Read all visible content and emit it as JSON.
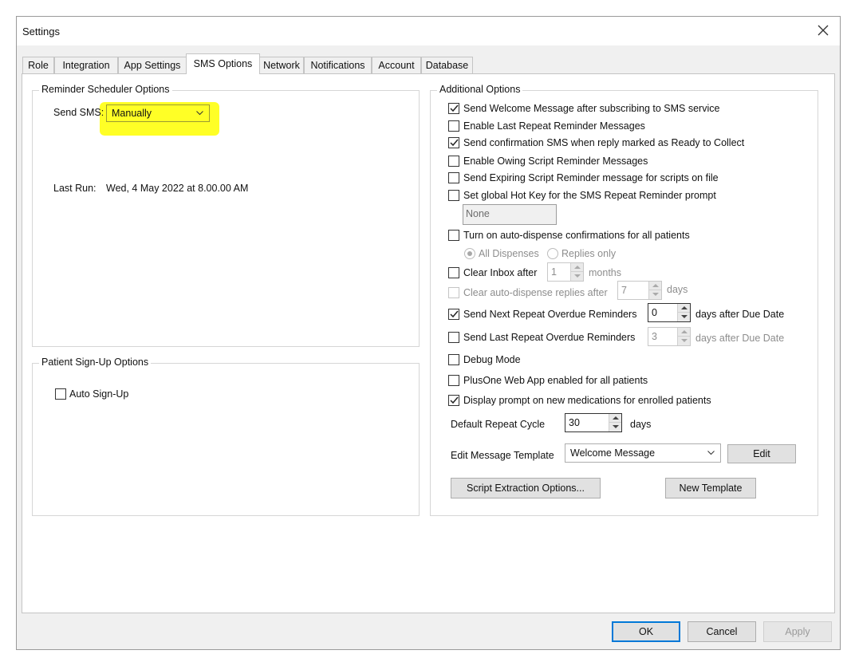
{
  "window": {
    "title": "Settings"
  },
  "tabs": [
    "Role",
    "Integration",
    "App Settings",
    "SMS Options",
    "Network",
    "Notifications",
    "Account",
    "Database"
  ],
  "reminder_scheduler": {
    "legend": "Reminder Scheduler Options",
    "send_sms_label": "Send SMS:",
    "send_sms_value": "Manually",
    "last_run_label": "Last Run:",
    "last_run_value": "Wed, 4 May 2022 at 8.00.00 AM"
  },
  "patient_signup": {
    "legend": "Patient Sign-Up Options",
    "auto_signup_label": "Auto Sign-Up",
    "auto_signup_checked": false
  },
  "additional": {
    "legend": "Additional Options",
    "welcome": "Send Welcome Message after subscribing to SMS service",
    "last_repeat": "Enable Last Repeat Reminder Messages",
    "confirmation": "Send confirmation SMS when reply marked as Ready to Collect",
    "owing_script": "Enable Owing Script Reminder Messages",
    "expiring_script": "Send Expiring Script Reminder message for scripts on file",
    "hot_key": "Set global Hot Key for the SMS Repeat Reminder prompt",
    "hot_key_value": "None",
    "auto_dispense": "Turn on auto-dispense confirmations for all patients",
    "all_dispenses": "All Dispenses",
    "replies_only": "Replies only",
    "clear_inbox": "Clear Inbox after",
    "clear_inbox_value": "1",
    "months": "months",
    "clear_auto": "Clear auto-dispense replies after",
    "clear_auto_value": "7",
    "days": "days",
    "next_overdue": "Send Next Repeat Overdue Reminders",
    "next_overdue_value": "0",
    "days_after_due": "days after Due Date",
    "last_overdue": "Send Last Repeat Overdue Reminders",
    "last_overdue_value": "3",
    "debug": "Debug Mode",
    "plusone": "PlusOne Web App enabled for all patients",
    "display_prompt": "Display prompt on new medications for enrolled patients",
    "repeat_cycle_label": "Default Repeat Cycle",
    "repeat_cycle_value": "30",
    "repeat_cycle_unit": "days",
    "template_label": "Edit Message Template",
    "template_value": "Welcome Message",
    "edit_btn": "Edit",
    "script_extraction_btn": "Script Extraction Options...",
    "new_template_btn": "New Template"
  },
  "footer": {
    "ok": "OK",
    "cancel": "Cancel",
    "apply": "Apply"
  },
  "colors": {
    "highlight": "#ffff00",
    "accent": "#0078d7"
  }
}
